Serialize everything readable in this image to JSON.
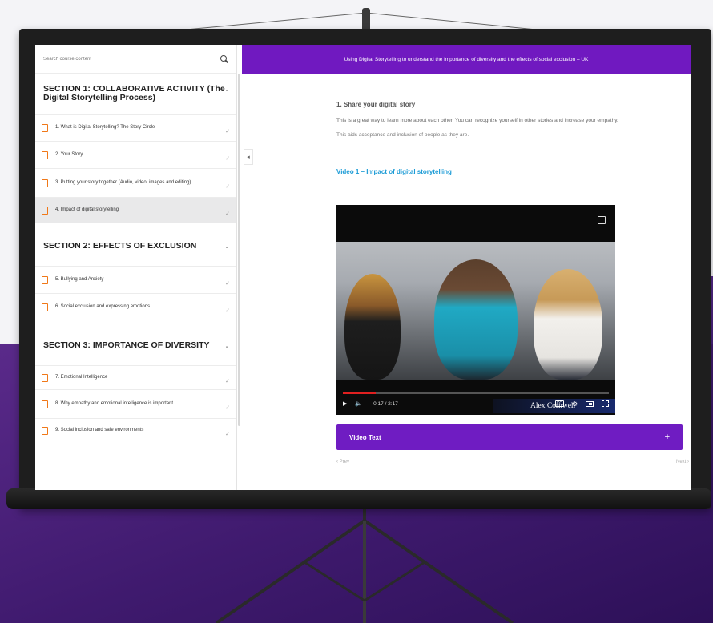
{
  "sidebar": {
    "search_placeholder": "Search course content",
    "sections": [
      {
        "title": "SECTION 1: COLLABORATIVE ACTIVITY (The Digital Storytelling Process)",
        "toggle": "-",
        "lessons": [
          "1. What is Digital Storytelling? The Story Circle",
          "2. Your Story",
          "3. Putting your story together (Audio, video, images and editing)",
          "4. Impact of digital storytelling"
        ]
      },
      {
        "title": "SECTION 2: EFFECTS OF EXCLUSION",
        "toggle": "-",
        "lessons": [
          "5. Bullying and Anxiety",
          "6. Social exclusion and expressing emotions"
        ]
      },
      {
        "title": "SECTION 3: IMPORTANCE OF DIVERSITY",
        "toggle": "-",
        "lessons": [
          "7. Emotional Intelligence",
          "8. Why empathy and emotional intelligence is important",
          "9. Social inclusion and safe environments"
        ]
      }
    ],
    "check": "✓",
    "collapse": "◂"
  },
  "topbar": {
    "title": "Using Digital Storytelling to understand the importance of diversity and the effects of social exclusion – UK"
  },
  "content": {
    "heading": "1. Share your digital story",
    "para1": "This is a great way to learn more about each other. You can recognize yourself in other stories and increase your empathy.",
    "para2": "This aids acceptance and inclusion of people as they are.",
    "video_title": "Video 1 – Impact of digital storytelling"
  },
  "video": {
    "caption": "Alex Cornwell",
    "time": "0:17 / 2:17",
    "progress": 0.124,
    "play": "▶",
    "volume": "🔈",
    "cc": "CC",
    "gear": "⚙"
  },
  "accordion": {
    "label": "Video Text",
    "plus": "+"
  },
  "nav": {
    "prev": "‹ Prev",
    "next": "Next ›"
  },
  "colors": {
    "accent_purple": "#7019c0",
    "link_blue": "#1b9bd6",
    "doc_orange": "#f07818"
  }
}
